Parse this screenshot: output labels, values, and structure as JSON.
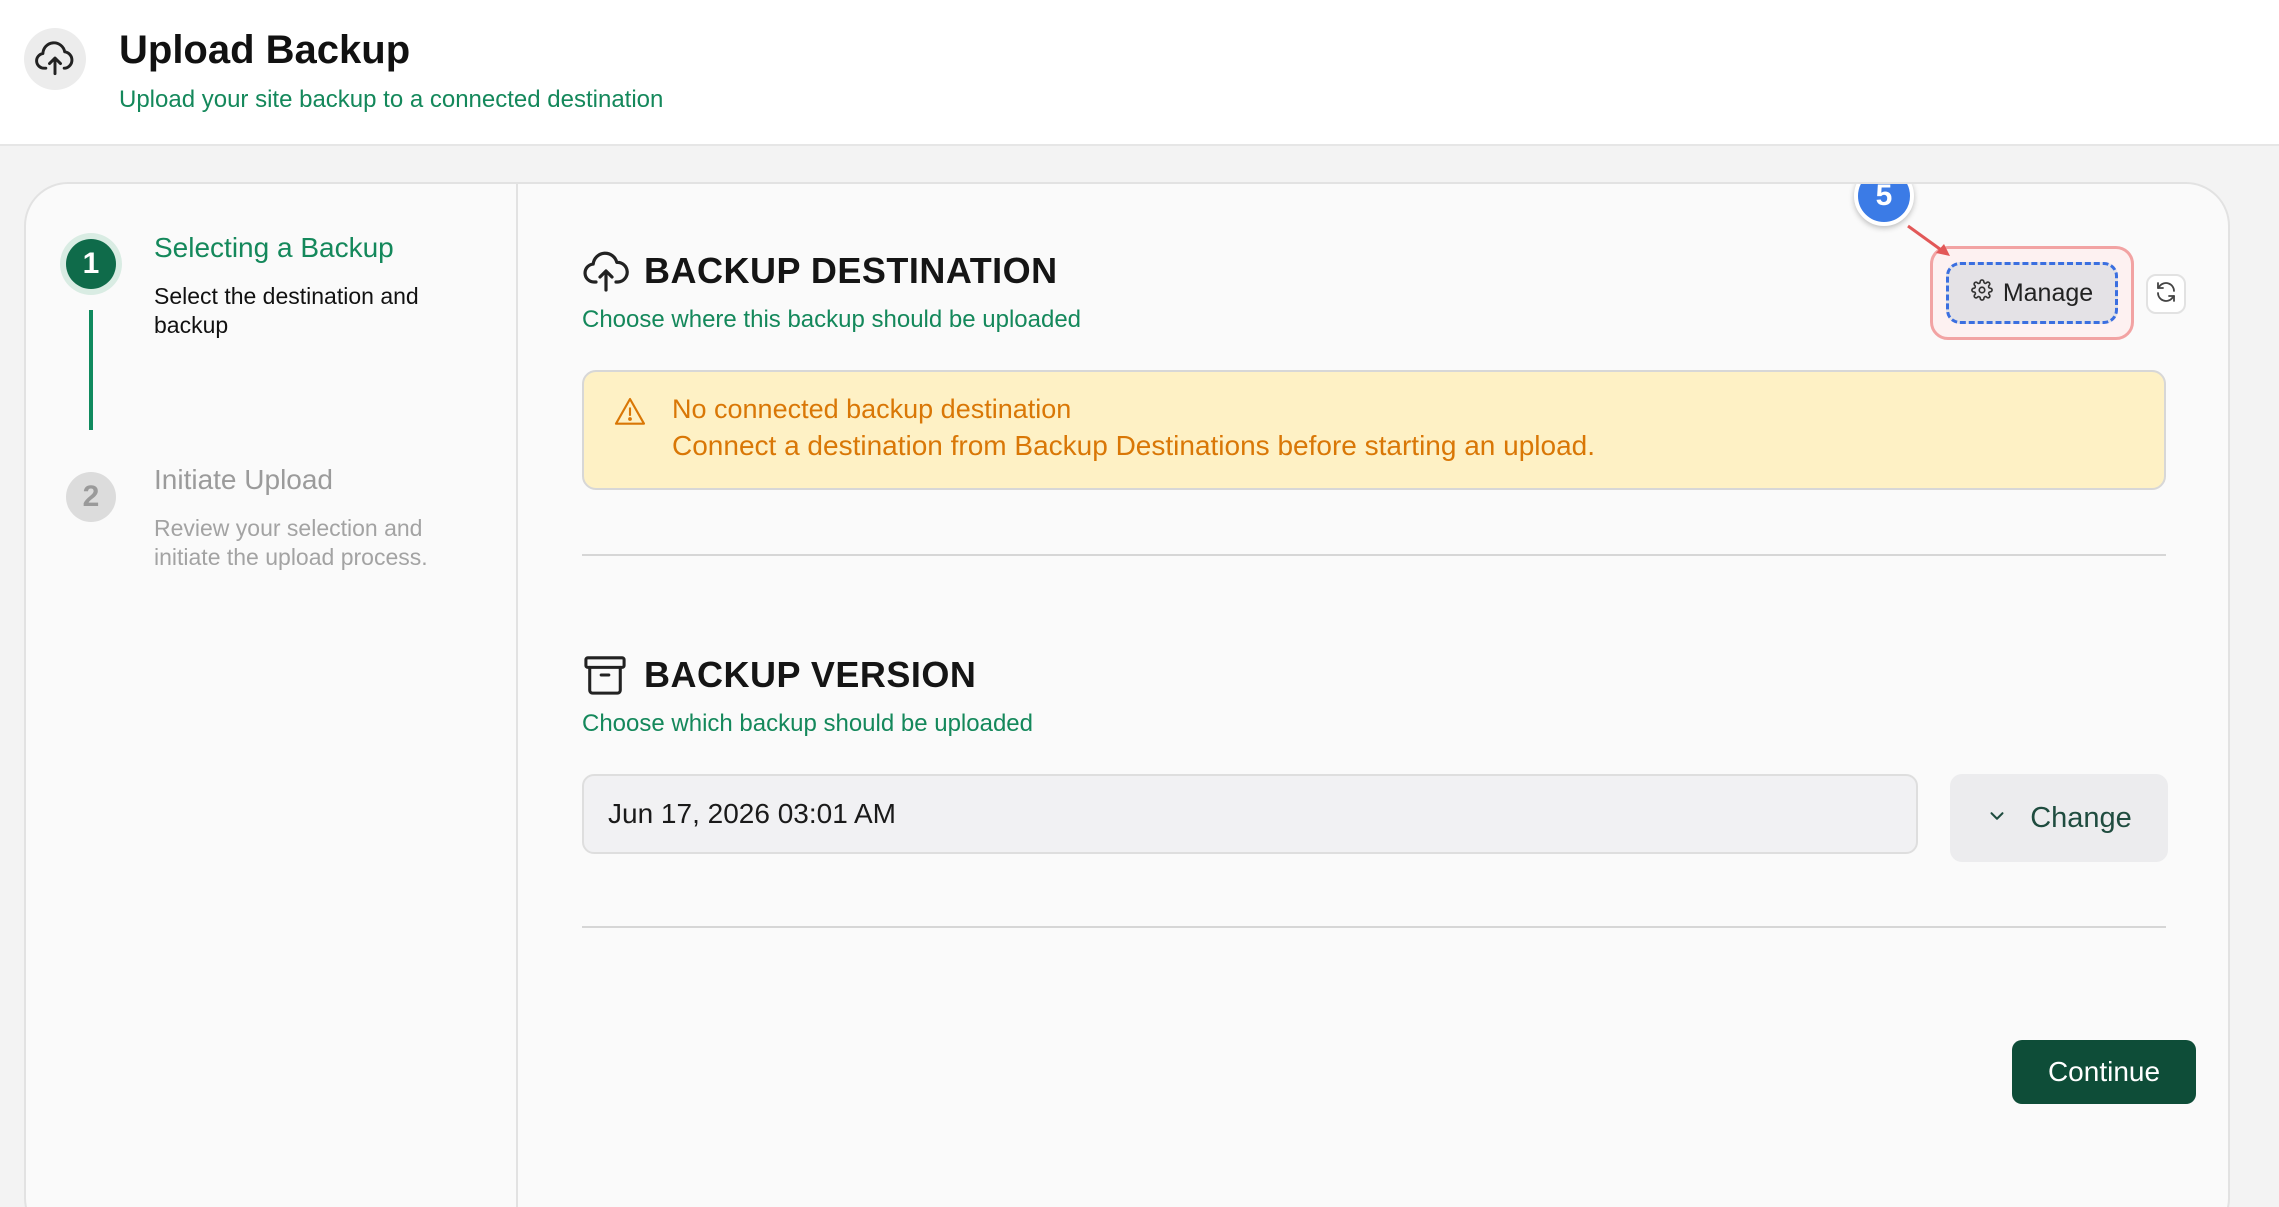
{
  "header": {
    "title": "Upload Backup",
    "subtitle": "Upload your site backup to a connected destination",
    "icon": "cloud-upload-icon"
  },
  "steps": [
    {
      "number": "1",
      "title": "Selecting a Backup",
      "description": "Select the destination and backup",
      "state": "active"
    },
    {
      "number": "2",
      "title": "Initiate Upload",
      "description": "Review your selection and initiate the upload process.",
      "state": "inactive"
    }
  ],
  "destination": {
    "title": "BACKUP DESTINATION",
    "subtitle": "Choose where this backup should be uploaded",
    "manage_label": "Manage",
    "annotation_badge": "5",
    "warning": {
      "title": "No connected backup destination",
      "text": "Connect a destination from Backup Destinations before starting an upload."
    }
  },
  "version": {
    "title": "BACKUP VERSION",
    "subtitle": "Choose which backup should be uploaded",
    "selected": "Jun 17, 2026 03:01 AM",
    "change_label": "Change"
  },
  "actions": {
    "continue_label": "Continue"
  },
  "colors": {
    "accent": "#14885b",
    "primary_button": "#0e4d38",
    "warning_bg": "#fef1c5",
    "warning_text": "#d97706",
    "badge": "#3b7be6"
  }
}
